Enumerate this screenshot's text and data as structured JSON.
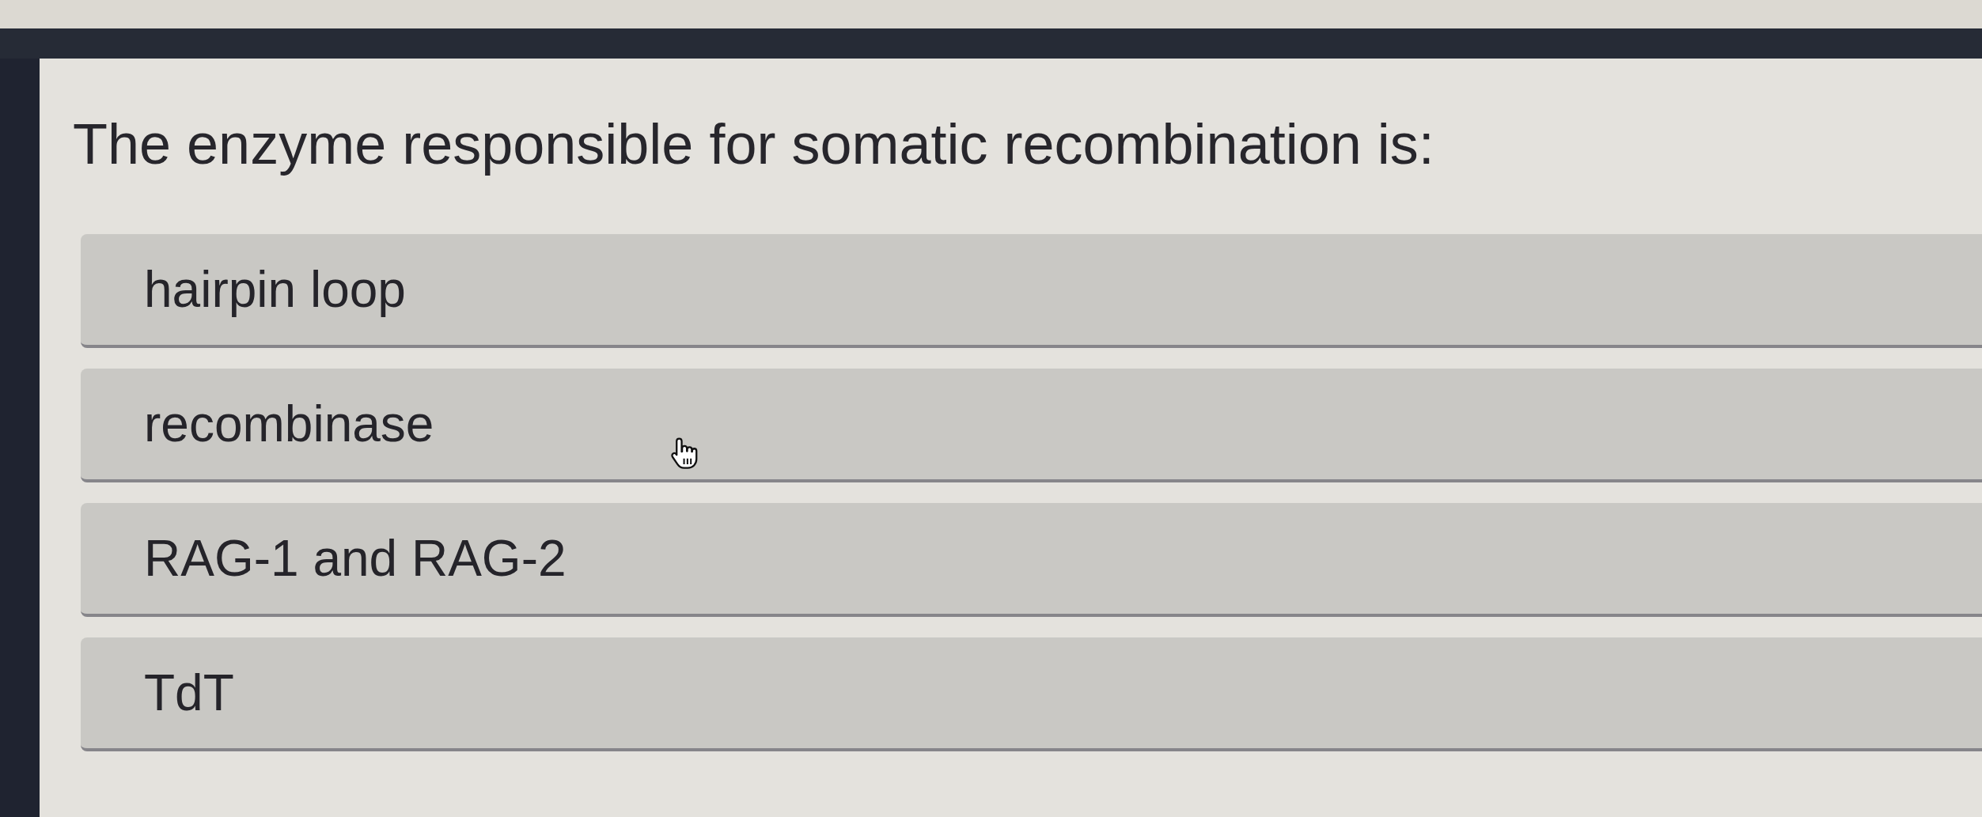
{
  "question": "The enzyme responsible for somatic recombination is:",
  "options": [
    {
      "label": "hairpin loop",
      "selected": false
    },
    {
      "label": "recombinase",
      "selected": false
    },
    {
      "label": "RAG-1 and RAG-2",
      "selected": false
    },
    {
      "label": "TdT",
      "selected": false
    }
  ]
}
